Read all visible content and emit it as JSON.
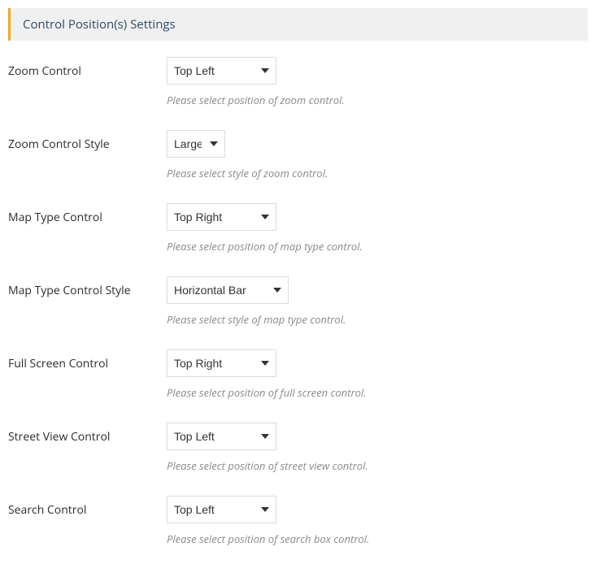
{
  "panel_title": "Control Position(s) Settings",
  "settings": [
    {
      "label": "Zoom Control",
      "value": "Top Left",
      "description": "Please select position of zoom control."
    },
    {
      "label": "Zoom Control Style",
      "value": "Large",
      "description": "Please select style of zoom control."
    },
    {
      "label": "Map Type Control",
      "value": "Top Right",
      "description": "Please select position of map type control."
    },
    {
      "label": "Map Type Control Style",
      "value": "Horizontal Bar",
      "description": "Please select style of map type control."
    },
    {
      "label": "Full Screen Control",
      "value": "Top Right",
      "description": "Please select position of full screen control."
    },
    {
      "label": "Street View Control",
      "value": "Top Left",
      "description": "Please select position of street view control."
    },
    {
      "label": "Search Control",
      "value": "Top Left",
      "description": "Please select position of search box control."
    }
  ]
}
